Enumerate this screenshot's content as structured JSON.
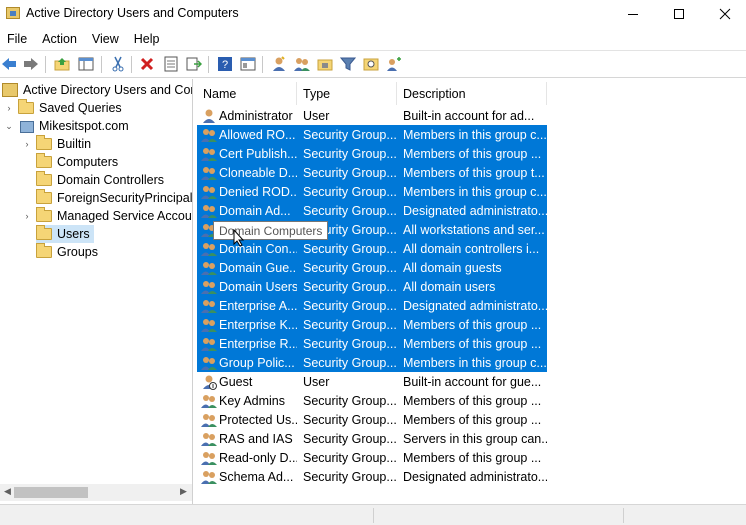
{
  "window": {
    "title": "Active Directory Users and Computers"
  },
  "menu": [
    "File",
    "Action",
    "View",
    "Help"
  ],
  "toolbar": {
    "icons": [
      "back-arrow-icon",
      "forward-arrow-icon",
      "up-folder-icon",
      "show-hide-console-tree-icon",
      "cut-icon",
      "delete-icon",
      "properties-icon",
      "export-list-icon",
      "help-icon",
      "show-details-icon",
      "new-user-icon",
      "new-group-icon",
      "new-ou-icon",
      "filter-icon",
      "find-icon",
      "add-to-group-icon"
    ]
  },
  "tree": {
    "root": "Active Directory Users and Com",
    "items": [
      {
        "label": "Saved Queries",
        "level": 1,
        "expander": "›",
        "icon": "folder"
      },
      {
        "label": "Mikesitspot.com",
        "level": 1,
        "expander": "⌄",
        "icon": "domain"
      },
      {
        "label": "Builtin",
        "level": 2,
        "expander": "›",
        "icon": "folder"
      },
      {
        "label": "Computers",
        "level": 2,
        "expander": "",
        "icon": "folder"
      },
      {
        "label": "Domain Controllers",
        "level": 2,
        "expander": "",
        "icon": "ou"
      },
      {
        "label": "ForeignSecurityPrincipals",
        "level": 2,
        "expander": "",
        "icon": "folder"
      },
      {
        "label": "Managed Service Accour",
        "level": 2,
        "expander": "›",
        "icon": "folder"
      },
      {
        "label": "Users",
        "level": 2,
        "expander": "",
        "icon": "folder",
        "selected": true
      },
      {
        "label": "Groups",
        "level": 2,
        "expander": "",
        "icon": "ou"
      }
    ]
  },
  "list": {
    "columns": [
      "Name",
      "Type",
      "Description"
    ],
    "rows": [
      {
        "name": "Administrator",
        "type": "User",
        "desc": "Built-in account for ad...",
        "icon": "user",
        "selected": false
      },
      {
        "name": "Allowed RO...",
        "type": "Security Group...",
        "desc": "Members in this group c...",
        "icon": "group",
        "selected": true
      },
      {
        "name": "Cert Publish...",
        "type": "Security Group...",
        "desc": "Members of this group ...",
        "icon": "group",
        "selected": true
      },
      {
        "name": "Cloneable D...",
        "type": "Security Group...",
        "desc": "Members of this group t...",
        "icon": "group",
        "selected": true
      },
      {
        "name": "Denied ROD...",
        "type": "Security Group...",
        "desc": "Members in this group c...",
        "icon": "group",
        "selected": true
      },
      {
        "name": "Domain Ad...",
        "type": "Security Group...",
        "desc": "Designated administrato...",
        "icon": "group",
        "selected": true
      },
      {
        "name": "Domain Co...",
        "type": "Security Group...",
        "desc": "All workstations and ser...",
        "icon": "group",
        "selected": true
      },
      {
        "name": "Domain Con...",
        "type": "Security Group...",
        "desc": "All domain controllers i...",
        "icon": "group",
        "selected": true
      },
      {
        "name": "Domain Gue...",
        "type": "Security Group...",
        "desc": "All domain guests",
        "icon": "group",
        "selected": true
      },
      {
        "name": "Domain Users",
        "type": "Security Group...",
        "desc": "All domain users",
        "icon": "group",
        "selected": true
      },
      {
        "name": "Enterprise A...",
        "type": "Security Group...",
        "desc": "Designated administrato...",
        "icon": "group",
        "selected": true
      },
      {
        "name": "Enterprise K...",
        "type": "Security Group...",
        "desc": "Members of this group ...",
        "icon": "group",
        "selected": true
      },
      {
        "name": "Enterprise R...",
        "type": "Security Group...",
        "desc": "Members of this group ...",
        "icon": "group",
        "selected": true
      },
      {
        "name": "Group Polic...",
        "type": "Security Group...",
        "desc": "Members in this group c...",
        "icon": "group",
        "selected": true
      },
      {
        "name": "Guest",
        "type": "User",
        "desc": "Built-in account for gue...",
        "icon": "user-disabled",
        "selected": false
      },
      {
        "name": "Key Admins",
        "type": "Security Group...",
        "desc": "Members of this group ...",
        "icon": "group",
        "selected": false
      },
      {
        "name": "Protected Us...",
        "type": "Security Group...",
        "desc": "Members of this group ...",
        "icon": "group",
        "selected": false
      },
      {
        "name": "RAS and IAS ...",
        "type": "Security Group...",
        "desc": "Servers in this group can...",
        "icon": "group",
        "selected": false
      },
      {
        "name": "Read-only D...",
        "type": "Security Group...",
        "desc": "Members of this group ...",
        "icon": "group",
        "selected": false
      },
      {
        "name": "Schema Ad...",
        "type": "Security Group...",
        "desc": "Designated administrato...",
        "icon": "group",
        "selected": false
      }
    ]
  },
  "tooltip": "Domain Computers",
  "colors": {
    "selection": "#0078d7",
    "tree_selection": "#cce4f7",
    "folder": "#f5d576"
  }
}
